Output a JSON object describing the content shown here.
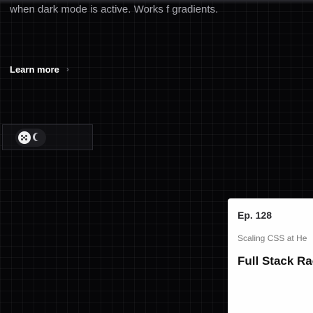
{
  "hero": {
    "description": "when dark mode is active. Works f gradients."
  },
  "cta": {
    "learn_more_label": "Learn more",
    "chevron": "›"
  },
  "theme_toggle": {
    "state": "dark",
    "knob_icon": "dots-icon",
    "moon_icon": "moon-icon"
  },
  "episode_card": {
    "episode": "Ep. 128",
    "subtitle": "Scaling CSS at He",
    "title": "Full Stack Rac"
  },
  "colors": {
    "background": "#060608",
    "text_muted": "#a9a9b0",
    "card_bg": "#fefefe"
  }
}
